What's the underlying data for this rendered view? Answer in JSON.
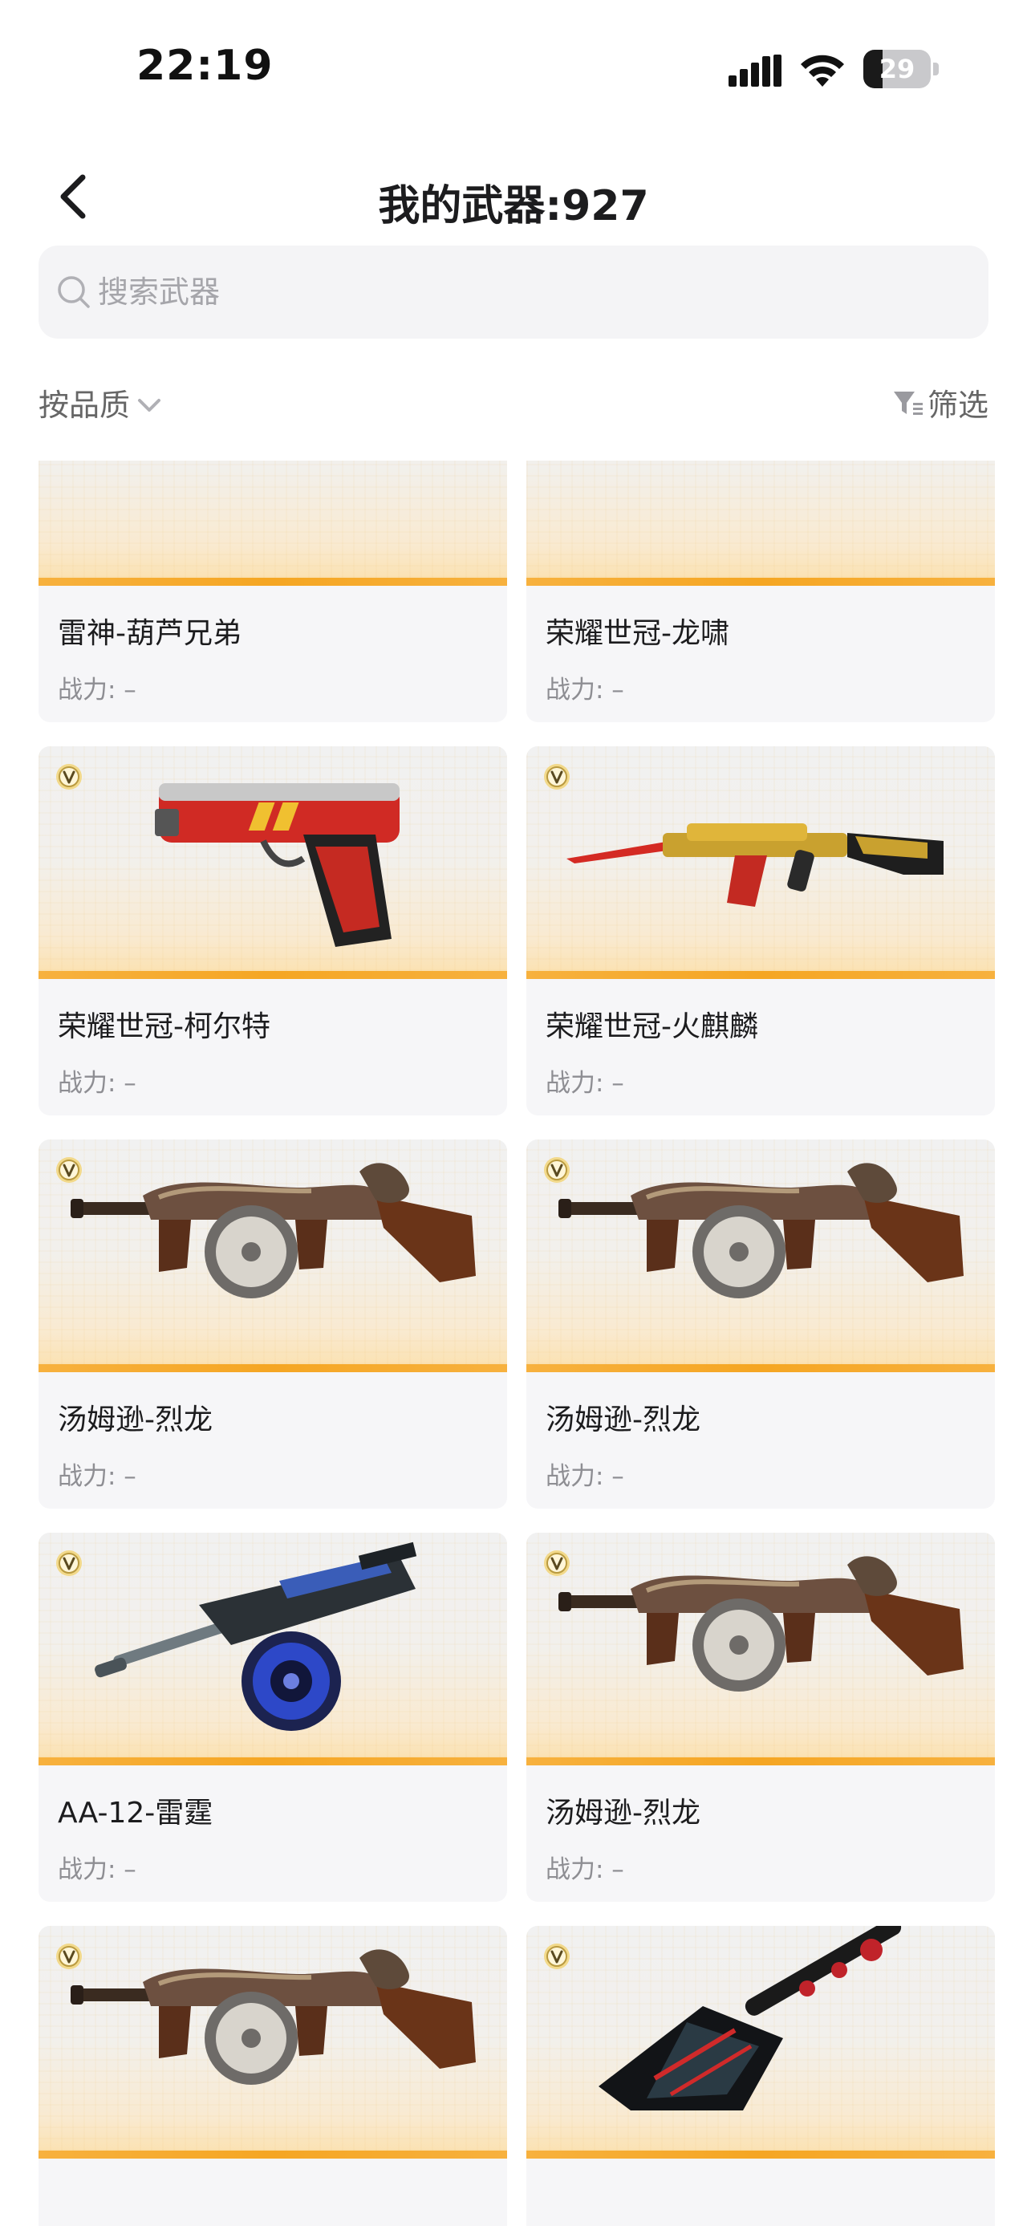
{
  "status_bar": {
    "time": "22:19",
    "battery_level": "29",
    "battery_fraction": 0.29
  },
  "header": {
    "title": "我的武器:927",
    "back_icon": "chevron-left-icon"
  },
  "search": {
    "placeholder": "搜索武器",
    "value": ""
  },
  "filters": {
    "sort_label": "按品质",
    "filter_label": "筛选"
  },
  "colors": {
    "accent_bar": "#f5a623",
    "card_bg": "#f6f6f8",
    "muted_text": "#8e8e93"
  },
  "weapons": [
    {
      "name": "雷神-葫芦兄弟",
      "power": "战力: –",
      "icon": "rifle-image",
      "vip": false
    },
    {
      "name": "荣耀世冠-龙啸",
      "power": "战力: –",
      "icon": "dragon-blade-image",
      "vip": false
    },
    {
      "name": "荣耀世冠-柯尔特",
      "power": "战力: –",
      "icon": "pistol-image",
      "vip": true
    },
    {
      "name": "荣耀世冠-火麒麟",
      "power": "战力: –",
      "icon": "ak-rifle-image",
      "vip": true
    },
    {
      "name": "汤姆逊-烈龙",
      "power": "战力: –",
      "icon": "tommy-gun-image",
      "vip": true
    },
    {
      "name": "汤姆逊-烈龙",
      "power": "战力: –",
      "icon": "tommy-gun-image",
      "vip": true
    },
    {
      "name": "AA-12-雷霆",
      "power": "战力: –",
      "icon": "shotgun-image",
      "vip": true
    },
    {
      "name": "汤姆逊-烈龙",
      "power": "战力: –",
      "icon": "tommy-gun-image",
      "vip": true
    },
    {
      "name": "",
      "power": "",
      "icon": "tommy-gun-image",
      "vip": true
    },
    {
      "name": "",
      "power": "",
      "icon": "shovel-image",
      "vip": true
    }
  ]
}
